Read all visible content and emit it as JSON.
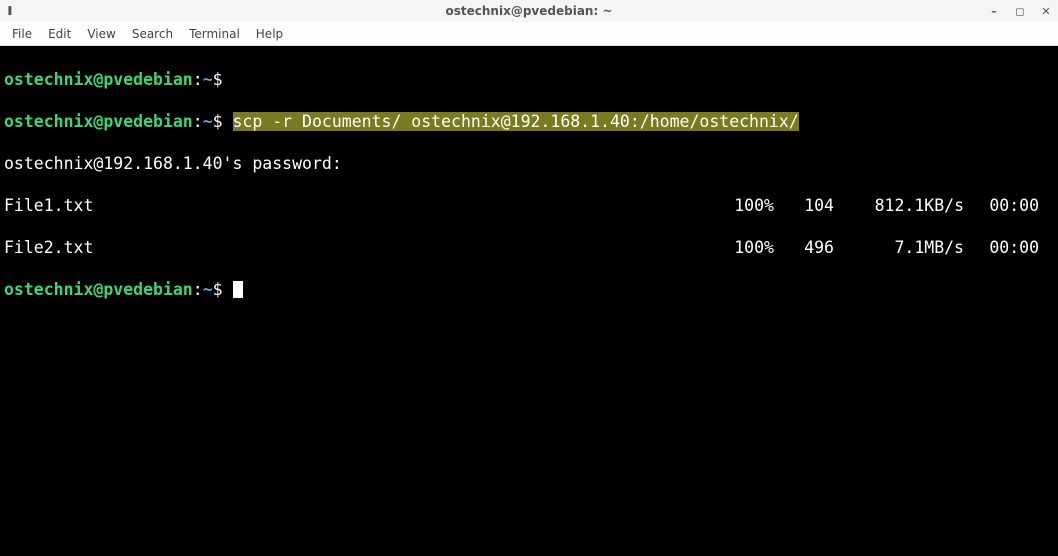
{
  "window": {
    "title": "ostechnix@pvedebian: ~",
    "icon_char": "❚"
  },
  "menubar": {
    "items": [
      "File",
      "Edit",
      "View",
      "Search",
      "Terminal",
      "Help"
    ]
  },
  "terminal": {
    "prompt": {
      "userhost": "ostechnix@pvedebian",
      "path": "~",
      "colon": ":",
      "symbol": "$"
    },
    "command": "scp -r Documents/ ostechnix@192.168.1.40:/home/ostechnix/",
    "password_prompt": "ostechnix@192.168.1.40's password:",
    "transfers": [
      {
        "file": "File1.txt",
        "pct": "100%",
        "bytes": "104",
        "rate": "812.1KB/s",
        "time": "00:00"
      },
      {
        "file": "File2.txt",
        "pct": "100%",
        "bytes": "496",
        "rate": "7.1MB/s",
        "time": "00:00"
      }
    ]
  },
  "controls": {
    "min": "–",
    "max": "◻",
    "close": "✕"
  }
}
